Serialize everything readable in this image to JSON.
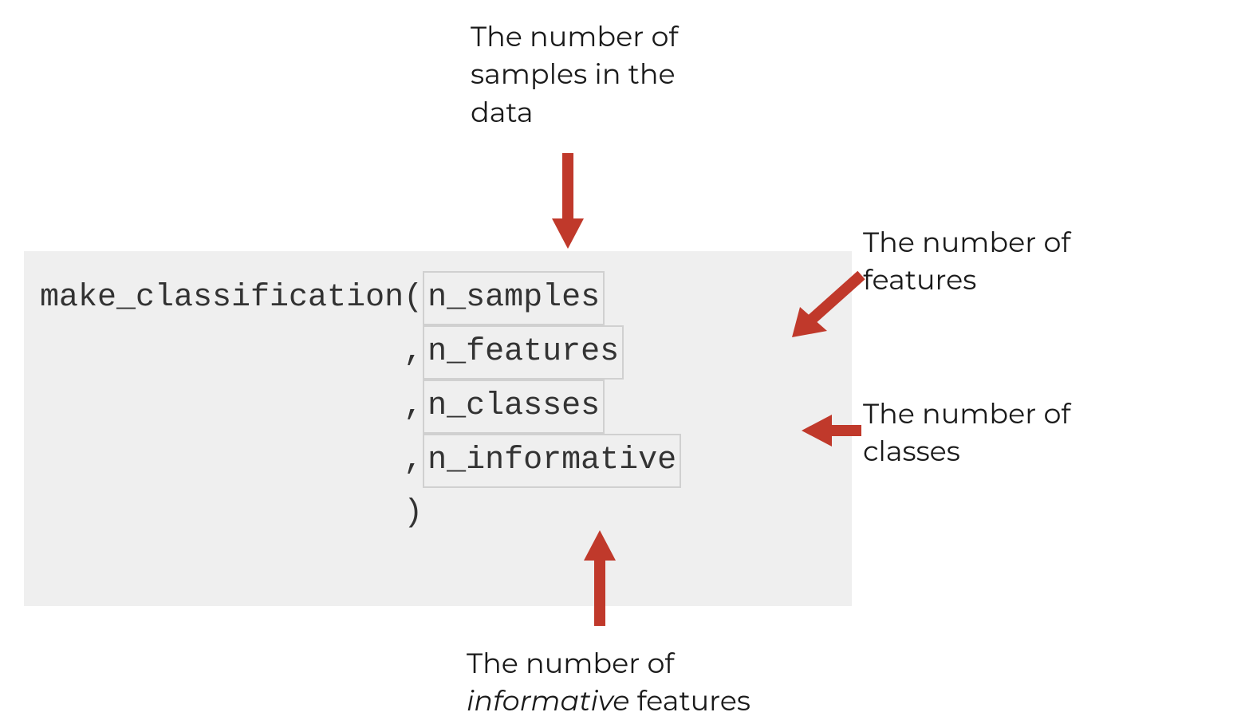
{
  "code": {
    "function_name": "make_classification(",
    "param1": "n_samples",
    "line2_prefix": "                   ,",
    "param2": "n_features",
    "line3_prefix": "                   ,",
    "param3": "n_classes",
    "line4_prefix": "                   ,",
    "param4": "n_informative",
    "line5": "                   )"
  },
  "annotations": {
    "samples": "The number of samples in the data",
    "features": "The number of features",
    "classes": "The number of classes",
    "informative_pre": "The number of ",
    "informative_italic": "informative",
    "informative_post": " features"
  },
  "colors": {
    "arrow": "#c0392b",
    "code_bg": "#efefef",
    "box_border": "#d0d0d0"
  }
}
